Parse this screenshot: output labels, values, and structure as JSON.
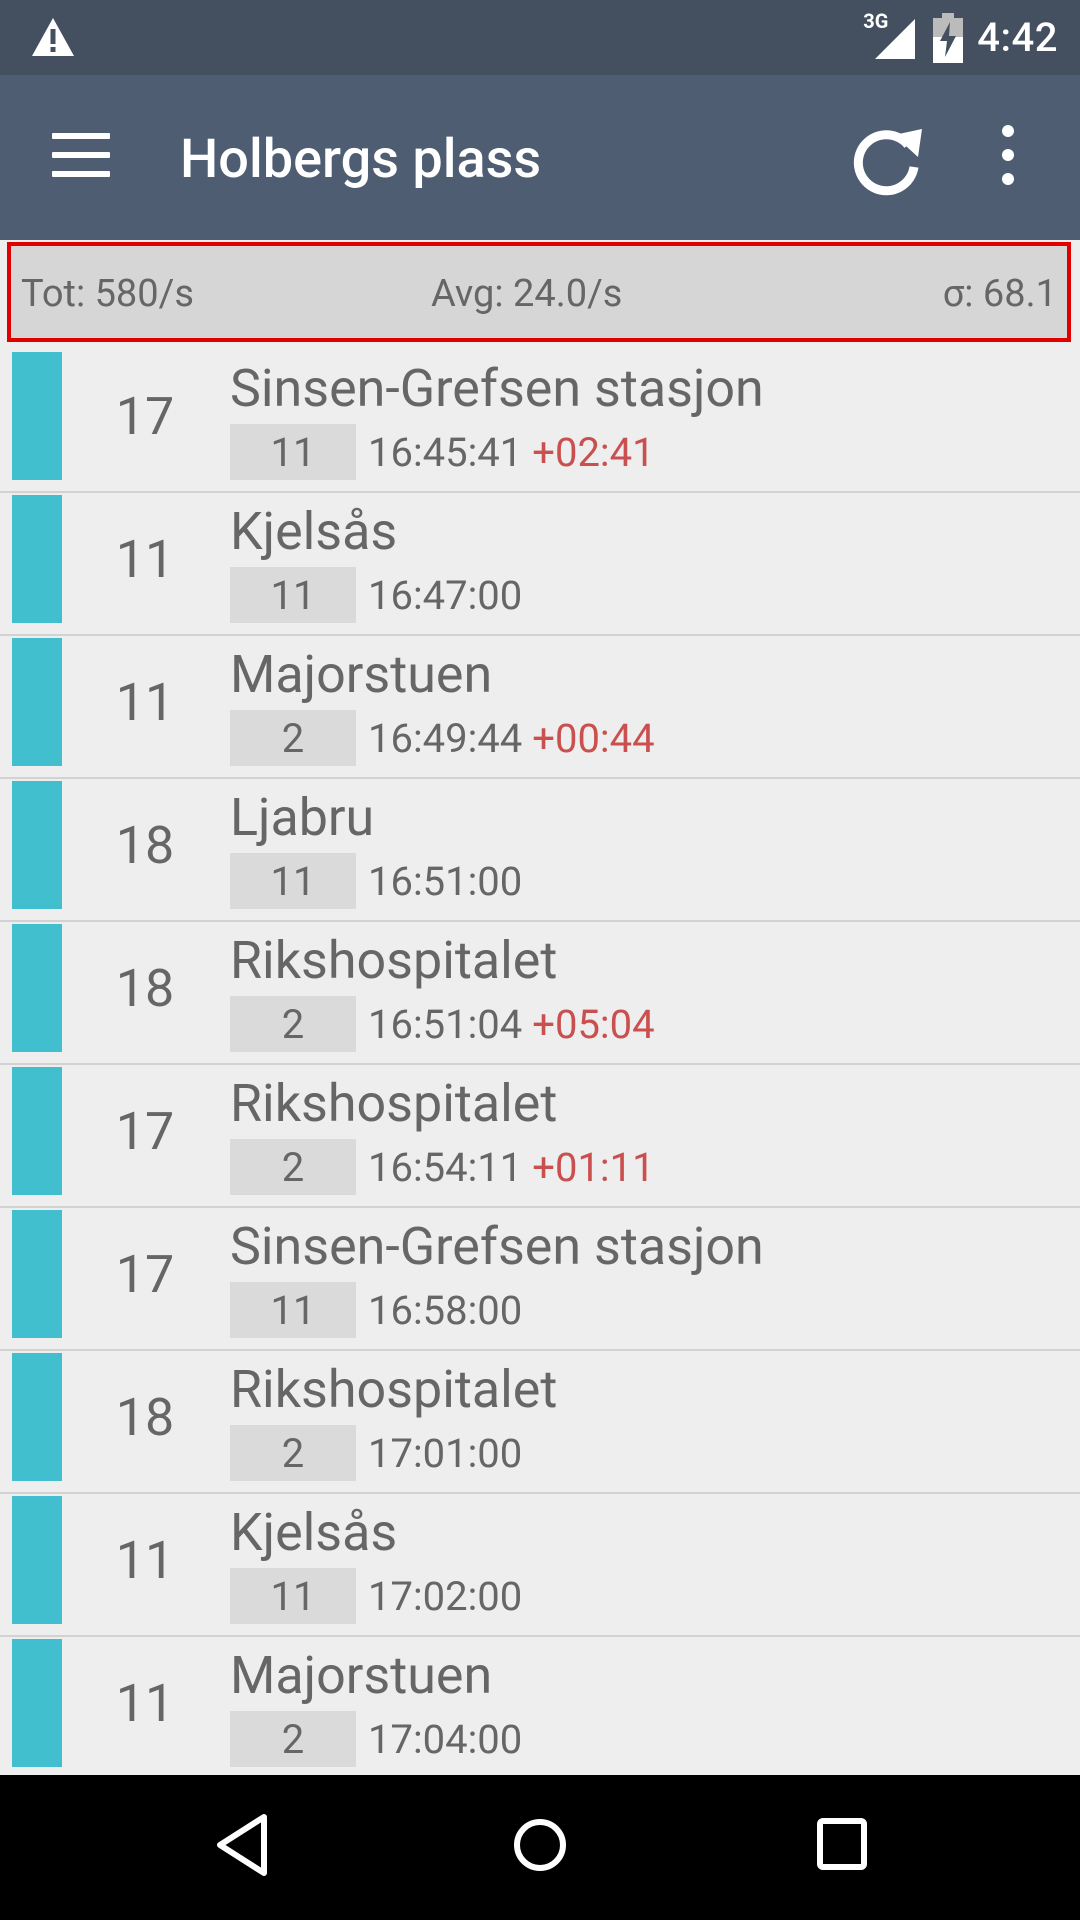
{
  "status_bar": {
    "warning_icon": "warning-icon",
    "network_label": "3G",
    "signal_icon": "signal-icon",
    "battery_icon": "battery-charging-icon",
    "time": "4:42"
  },
  "app_bar": {
    "menu_icon": "hamburger-menu-icon",
    "title": "Holbergs plass",
    "refresh_icon": "refresh-icon",
    "more_icon": "more-vert-icon",
    "background": "#4f5d73"
  },
  "stats": {
    "total": "Tot:  580/s",
    "average": "Avg:  24.0/s",
    "sigma": "σ: 68.1"
  },
  "departures": [
    {
      "line": "17",
      "destination": "Sinsen-Grefsen stasjon",
      "platform": "11",
      "time": "16:45:41",
      "delay": "+02:41"
    },
    {
      "line": "11",
      "destination": "Kjelsås",
      "platform": "11",
      "time": "16:47:00",
      "delay": ""
    },
    {
      "line": "11",
      "destination": "Majorstuen",
      "platform": "2",
      "time": "16:49:44",
      "delay": "+00:44"
    },
    {
      "line": "18",
      "destination": "Ljabru",
      "platform": "11",
      "time": "16:51:00",
      "delay": ""
    },
    {
      "line": "18",
      "destination": "Rikshospitalet",
      "platform": "2",
      "time": "16:51:04",
      "delay": "+05:04"
    },
    {
      "line": "17",
      "destination": "Rikshospitalet",
      "platform": "2",
      "time": "16:54:11",
      "delay": "+01:11"
    },
    {
      "line": "17",
      "destination": "Sinsen-Grefsen stasjon",
      "platform": "11",
      "time": "16:58:00",
      "delay": ""
    },
    {
      "line": "18",
      "destination": "Rikshospitalet",
      "platform": "2",
      "time": "17:01:00",
      "delay": ""
    },
    {
      "line": "11",
      "destination": "Kjelsås",
      "platform": "11",
      "time": "17:02:00",
      "delay": ""
    },
    {
      "line": "11",
      "destination": "Majorstuen",
      "platform": "2",
      "time": "17:04:00",
      "delay": ""
    }
  ],
  "colors": {
    "line_bar": "#41bfcf",
    "delay": "#c9504f",
    "highlight_border": "#e00000"
  },
  "nav_bar": {
    "back_icon": "back-icon",
    "home_icon": "home-icon",
    "recents_icon": "recents-icon"
  }
}
